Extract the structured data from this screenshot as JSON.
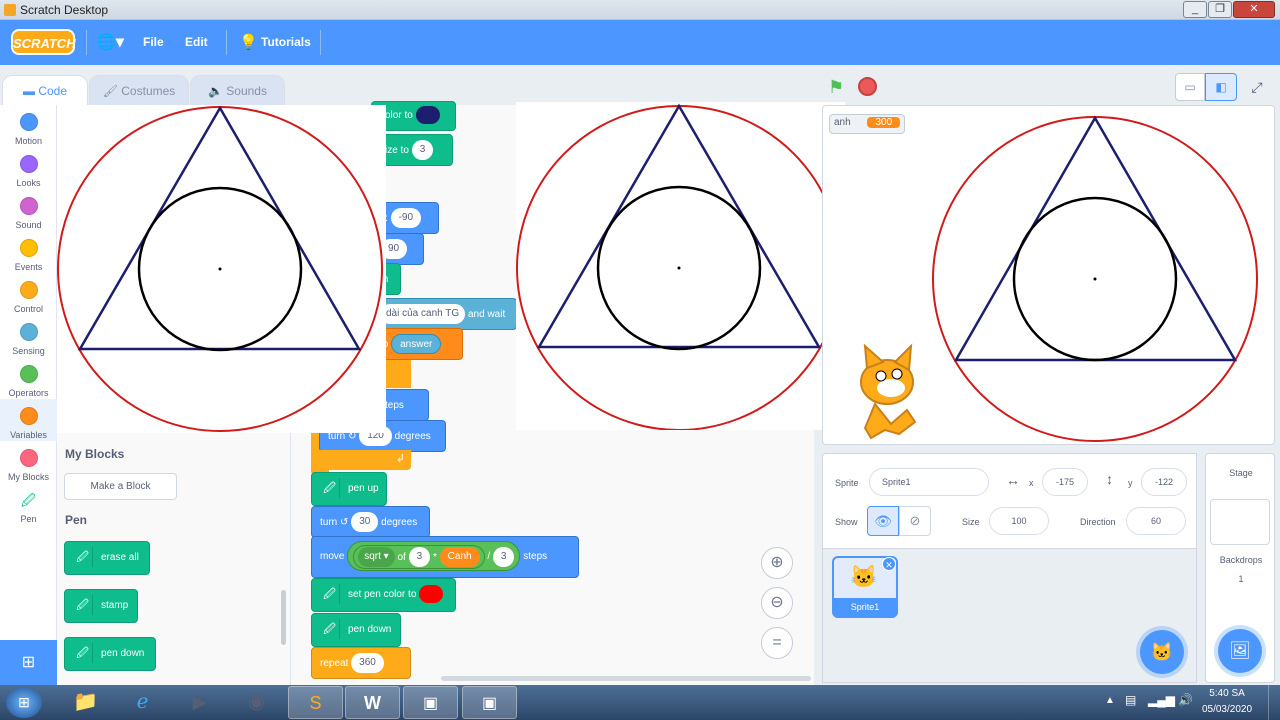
{
  "window": {
    "title": "Scratch Desktop"
  },
  "menubar": {
    "logo": "SCRATCH",
    "file": "File",
    "edit": "Edit",
    "tutorials": "Tutorials"
  },
  "tabs": {
    "code": "Code",
    "costumes": "Costumes",
    "sounds": "Sounds"
  },
  "categories": [
    {
      "label": "Motion",
      "color": "#4c97ff"
    },
    {
      "label": "Looks",
      "color": "#9966ff"
    },
    {
      "label": "Sound",
      "color": "#cf63cf"
    },
    {
      "label": "Events",
      "color": "#ffbf00"
    },
    {
      "label": "Control",
      "color": "#ffab19"
    },
    {
      "label": "Sensing",
      "color": "#5cb1d6"
    },
    {
      "label": "Operators",
      "color": "#59c059"
    },
    {
      "label": "Variables",
      "color": "#ff8c1a"
    },
    {
      "label": "My Blocks",
      "color": "#ff6680"
    },
    {
      "label": "Pen",
      "color": "#0fbd8c"
    }
  ],
  "palette": {
    "my_blocks_heading": "My Blocks",
    "make_block": "Make a Block",
    "pen_heading": "Pen",
    "erase_all": "erase all",
    "stamp": "stamp",
    "pen_down": "pen down"
  },
  "workspace": {
    "color_to": "color to",
    "size_to": "size to",
    "size_val": "3",
    "y_label": "y:",
    "y_val": "-90",
    "dir_val": "90",
    "m_text": "m",
    "ask_text": "dài của canh TG",
    "and_wait": "and wait",
    "to_text": "to",
    "answer": "answer",
    "steps": "steps",
    "turn": "turn",
    "turn_val": "120",
    "degrees": "degrees",
    "pen_up": "pen up",
    "turn2_val": "30",
    "move": "move",
    "sqrt": "sqrt",
    "of": "of",
    "three": "3",
    "times": "*",
    "canh": "Canh",
    "divide": "/",
    "three2": "3",
    "set_pen_color": "set pen color to",
    "pen_down": "pen down",
    "repeat": "repeat",
    "repeat_val": "360",
    "pen_color_hex": "#ff0000",
    "navy_hex": "#1e1e6e"
  },
  "stage": {
    "var_name": "anh",
    "var_value": "300"
  },
  "sprite": {
    "sprite_label": "Sprite",
    "sprite_name": "Sprite1",
    "x_label": "x",
    "x_val": "-175",
    "y_label": "y",
    "y_val": "-122",
    "show_label": "Show",
    "size_label": "Size",
    "size_val": "100",
    "direction_label": "Direction",
    "direction_val": "60",
    "thumb_name": "Sprite1"
  },
  "stage_pane": {
    "title": "Stage",
    "backdrops_label": "Backdrops",
    "backdrops_count": "1"
  },
  "taskbar": {
    "time": "5:40 SA",
    "date": "05/03/2020"
  }
}
